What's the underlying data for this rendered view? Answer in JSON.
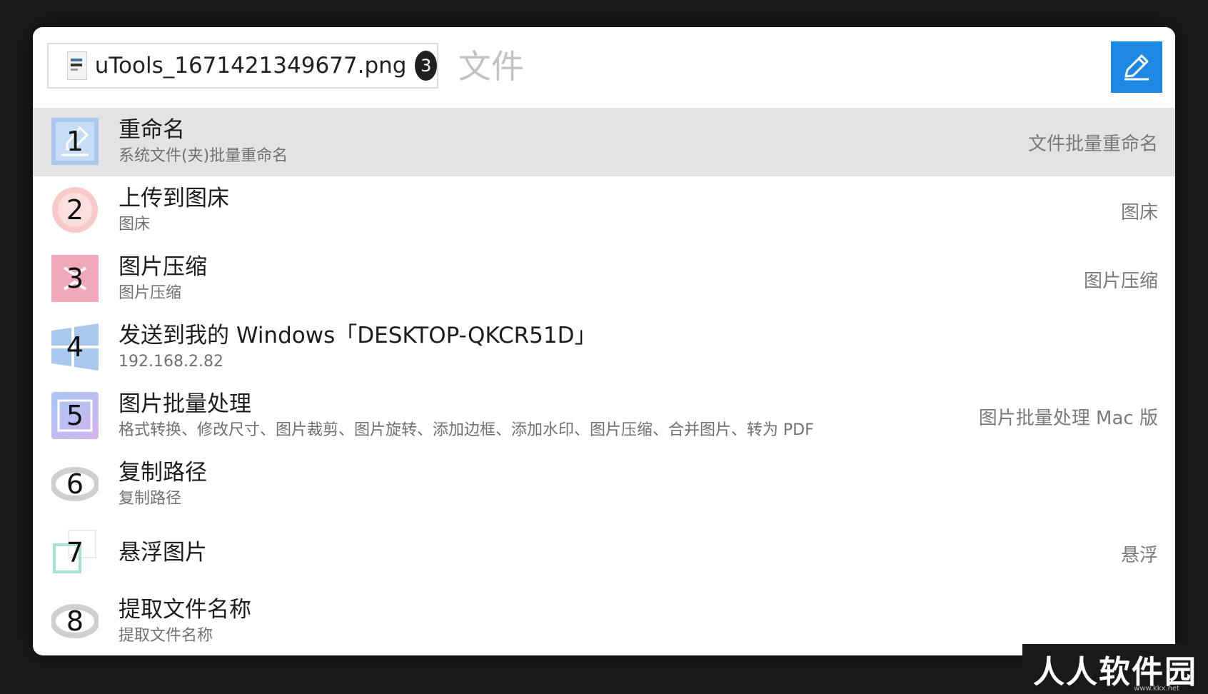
{
  "header": {
    "file_name": "uTools_1671421349677.png",
    "file_count": "3",
    "search_placeholder": "文件"
  },
  "items": [
    {
      "num": "1",
      "title": "重命名",
      "subtitle": "系统文件(夹)批量重命名",
      "right": "文件批量重命名",
      "selected": true
    },
    {
      "num": "2",
      "title": "上传到图床",
      "subtitle": "图床",
      "right": "图床"
    },
    {
      "num": "3",
      "title": "图片压缩",
      "subtitle": "图片压缩",
      "right": "图片压缩"
    },
    {
      "num": "4",
      "title": "发送到我的 Windows「DESKTOP-QKCR51D」",
      "subtitle": "192.168.2.82",
      "right": ""
    },
    {
      "num": "5",
      "title": "图片批量处理",
      "subtitle": "格式转换、修改尺寸、图片裁剪、图片旋转、添加边框、添加水印、图片压缩、合并图片、转为 PDF",
      "right": "图片批量处理 Mac 版"
    },
    {
      "num": "6",
      "title": "复制路径",
      "subtitle": "复制路径",
      "right": ""
    },
    {
      "num": "7",
      "title": "悬浮图片",
      "subtitle": "",
      "right": "悬浮"
    },
    {
      "num": "8",
      "title": "提取文件名称",
      "subtitle": "提取文件名称",
      "right": ""
    }
  ],
  "watermark": {
    "text": "人人软件园",
    "sub": "www.kkx.net"
  }
}
